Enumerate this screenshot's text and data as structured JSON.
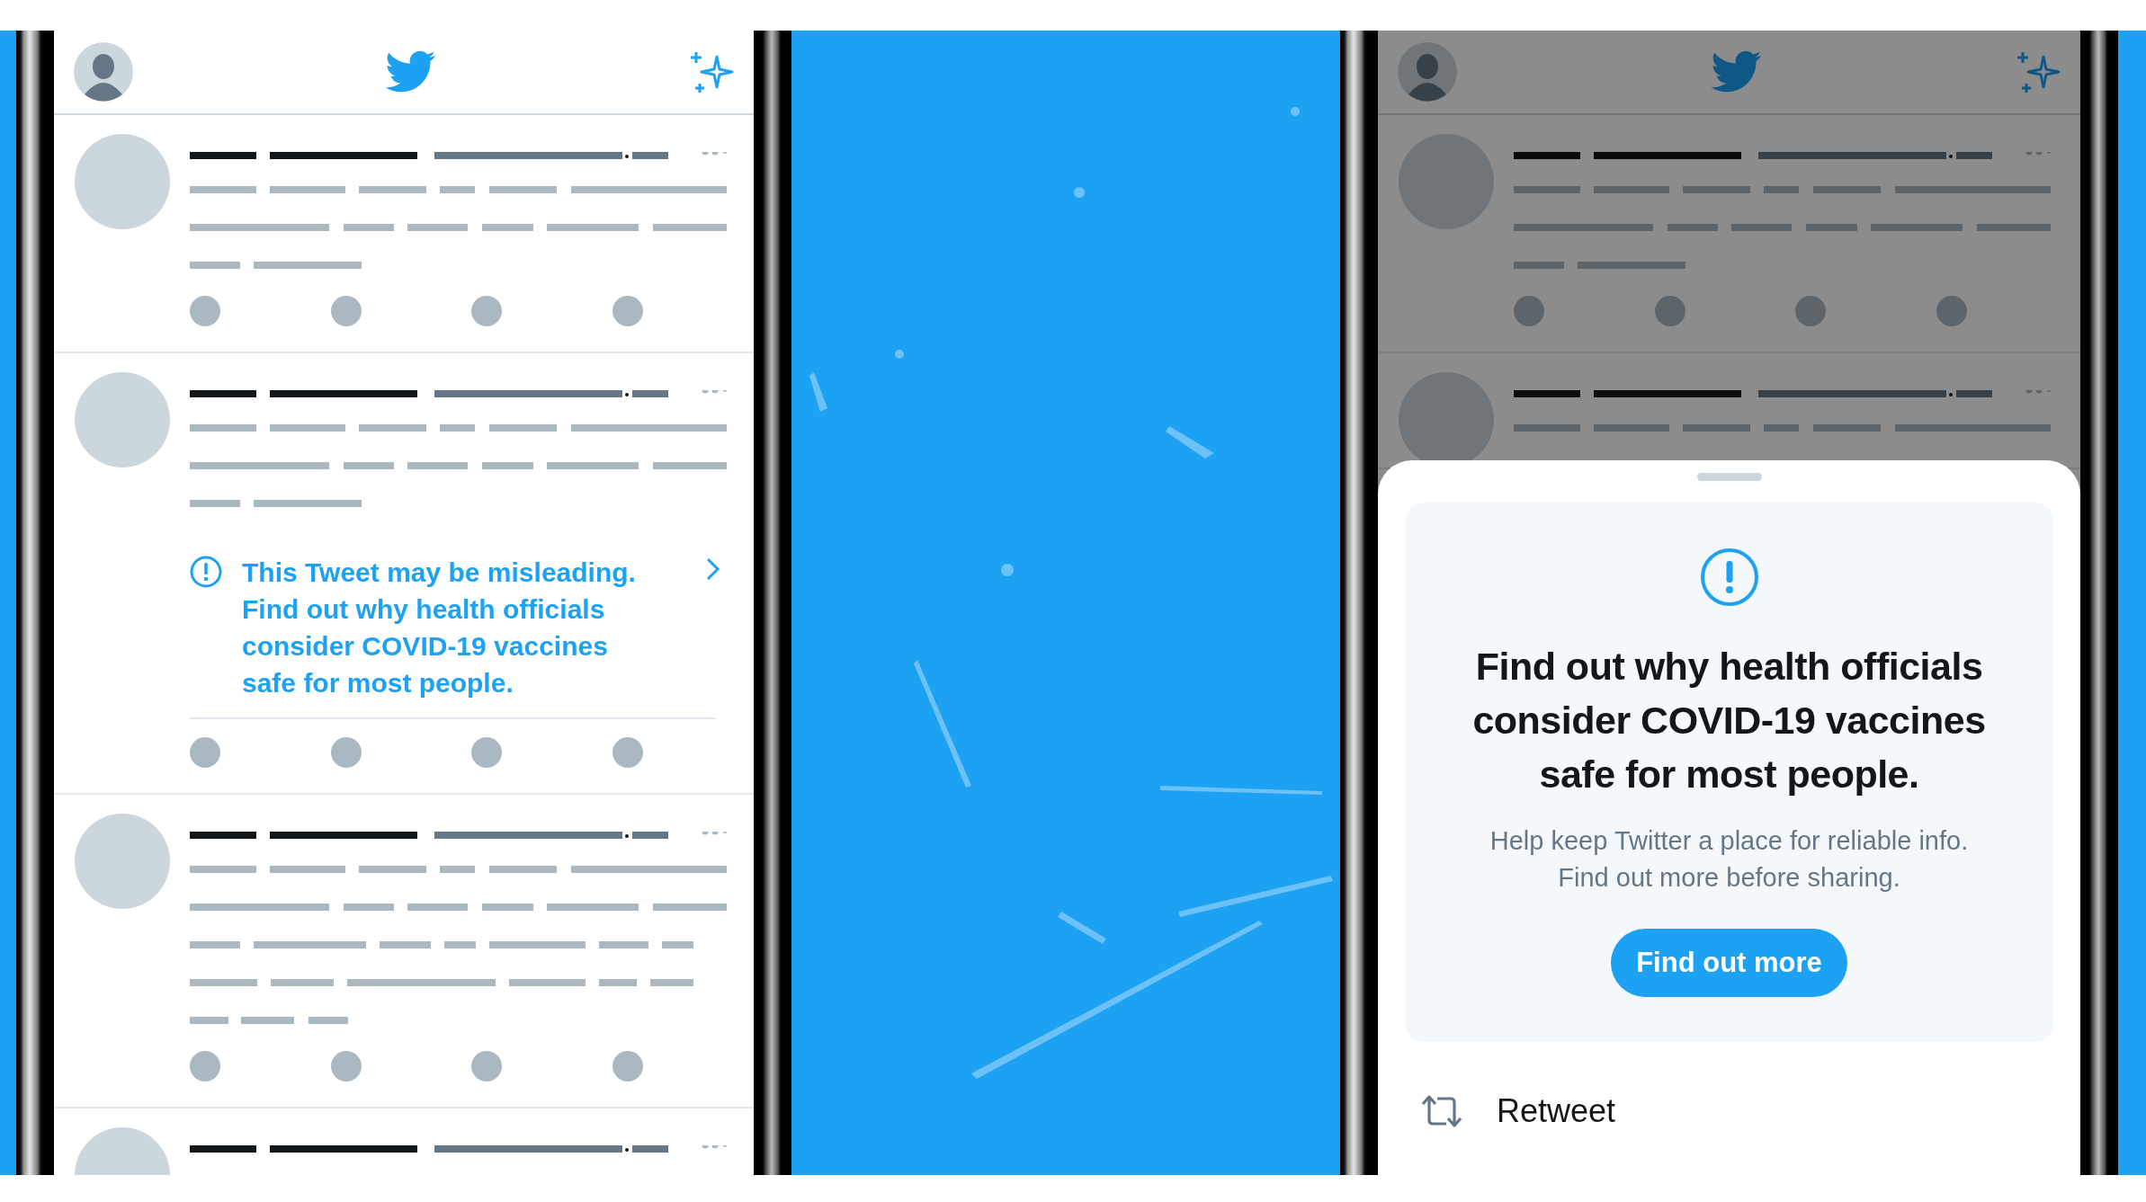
{
  "panels": [
    {
      "kind": "phone",
      "dimmed": false,
      "tweets": [
        {
          "kind": "skeleton"
        },
        {
          "kind": "labeled",
          "label": "This Tweet may be misleading. Find out why health officials consider COVID-19 vaccines safe for most people."
        },
        {
          "kind": "long"
        },
        {
          "kind": "header_only"
        }
      ]
    },
    {
      "kind": "picture"
    },
    {
      "kind": "phone",
      "dimmed": true,
      "tweets": [
        {
          "kind": "skeleton"
        },
        {
          "kind": "one_row"
        }
      ],
      "sheet": {
        "title": "Find out why health officials consider COVID-19 vaccines safe for most people.",
        "body": "Help keep Twitter a place for reliable info. Find out more before sharing.",
        "button": "Find out more",
        "actions": [
          {
            "label": "Retweet"
          }
        ]
      }
    }
  ]
}
